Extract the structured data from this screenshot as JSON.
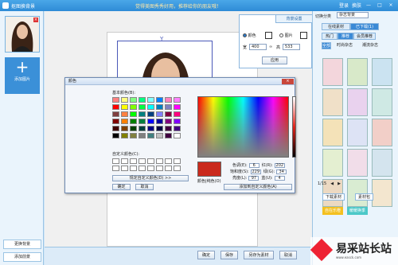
{
  "titlebar": {
    "app_title": "抠图换背景",
    "slogan": "觉得美图秀秀好用，推荐给你的朋友哦！",
    "login": "登录",
    "skin": "换肤",
    "minimize": "—",
    "maximize": "□",
    "close": "×"
  },
  "left_panel": {
    "add_picture": "添加图片",
    "change_background": "更换背景",
    "add_foreground": "添加前景"
  },
  "color_dialog": {
    "title": "颜色",
    "close": "×",
    "basic_colors": "基本颜色(B):",
    "custom_colors": "自定义颜色(C):",
    "define_custom": "规定自定义颜色(D) >>",
    "ok": "确定",
    "cancel": "取消",
    "color_solid": "颜色|纯色(O)",
    "add_custom": "添加到自定义颜色(A)",
    "hue_label": "色调(E):",
    "hue": "6",
    "sat_label": "饱和度(S):",
    "sat": "229",
    "lum_label": "亮度(L):",
    "lum": "97",
    "red_label": "红(R):",
    "red": "202",
    "green_label": "绿(G):",
    "green": "34",
    "blue_label": "蓝(U):",
    "blue": "4",
    "selected_color": "#ca2a1c",
    "basic_swatches": [
      "#ff8080",
      "#ffff80",
      "#80ff80",
      "#00ff80",
      "#80ffff",
      "#0080ff",
      "#ff80c0",
      "#ff80ff",
      "#ff0000",
      "#ffff00",
      "#80ff00",
      "#00ff40",
      "#00ffff",
      "#0080c0",
      "#8080c0",
      "#ff00ff",
      "#804040",
      "#ff8040",
      "#00ff00",
      "#008080",
      "#004080",
      "#8080ff",
      "#800040",
      "#ff0080",
      "#800000",
      "#ff8000",
      "#008000",
      "#008040",
      "#0000ff",
      "#0000a0",
      "#800080",
      "#8000ff",
      "#400000",
      "#804000",
      "#004000",
      "#004040",
      "#000080",
      "#000040",
      "#400040",
      "#400080",
      "#000000",
      "#808000",
      "#808040",
      "#808080",
      "#408080",
      "#c0c0c0",
      "#400040",
      "#ffffff"
    ]
  },
  "bg_settings": {
    "header": "背景设置",
    "color_option": "颜色",
    "image_option": "图片",
    "width_label": "宽",
    "width": "400",
    "height_label": "高",
    "height": "533",
    "lock_icon": "link-icon",
    "apply": "应用"
  },
  "right_panel": {
    "switch_label": "切换分类",
    "category": "杂志背景",
    "tabs": [
      "在线素材",
      "已下载(1)"
    ],
    "subtabs": [
      "热门",
      "推荐",
      "会员推荐"
    ],
    "filter_labels": [
      "全部",
      "时尚杂志",
      "潮流杂志"
    ],
    "page": "1/15",
    "download_btn": "下载素材",
    "material_btn": "素材包",
    "banner1": "自在乐橙",
    "banner2": "暖暖换季"
  },
  "bottom_bar": {
    "ok": "确定",
    "save": "保存",
    "save_as_material": "另存为素材",
    "cancel": "取消"
  },
  "watermark": {
    "text": "易采站长站",
    "sub": "www.easck.com"
  }
}
